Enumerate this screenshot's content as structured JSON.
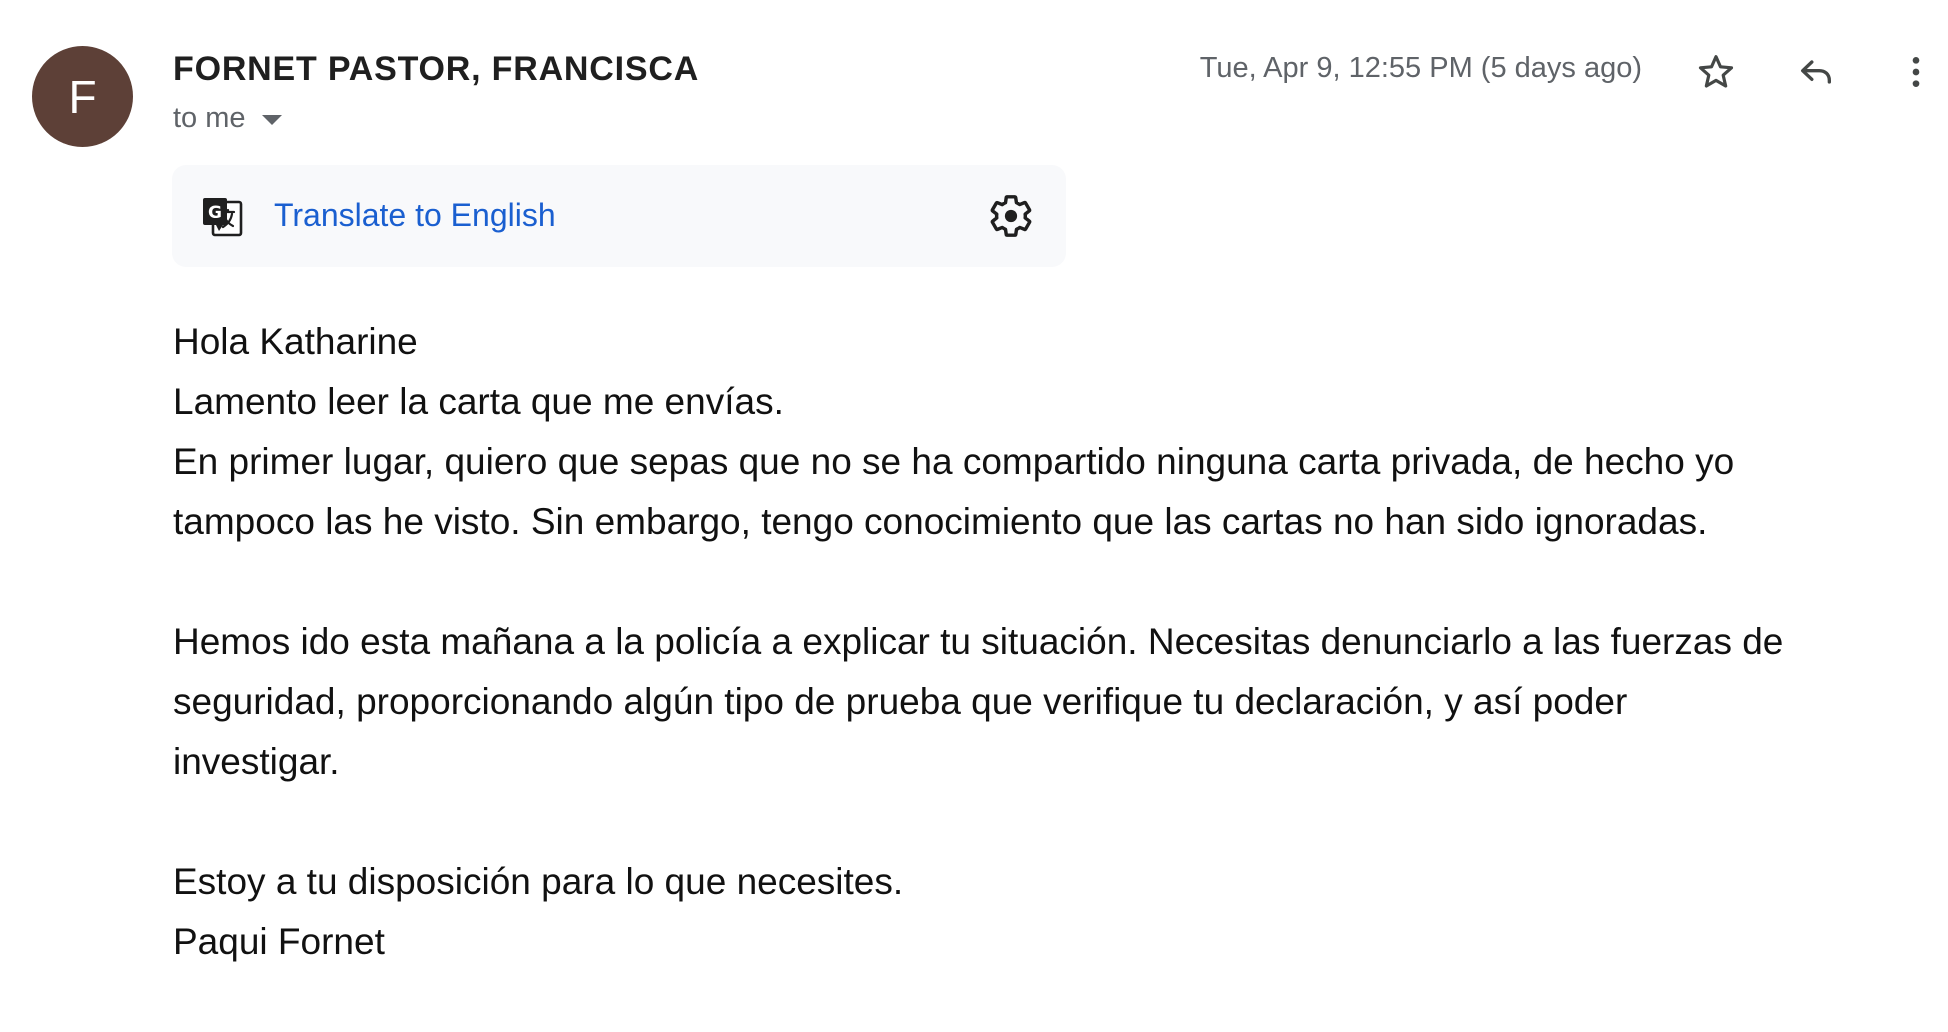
{
  "sender": {
    "avatar_letter": "F",
    "avatar_color": "#5d4037",
    "name": "FORNET PASTOR, FRANCISCA"
  },
  "recipient": {
    "label": "to me"
  },
  "timestamp": "Tue, Apr 9, 12:55 PM (5 days ago)",
  "actions": {
    "star_icon": "star-icon",
    "reply_icon": "reply-icon",
    "more_icon": "more-vert-icon"
  },
  "translate_bar": {
    "icon": "translate-icon",
    "link_label": "Translate to English",
    "settings_icon": "gear-icon"
  },
  "body": {
    "line1": "Hola Katharine",
    "line2": "Lamento leer la carta que me envías.",
    "line3": "En primer lugar, quiero que sepas que no se ha compartido ninguna carta privada, de hecho yo",
    "line4": "tampoco las he visto. Sin embargo, tengo conocimiento que las cartas no han sido ignoradas.",
    "line5": "Hemos ido esta mañana a la policía a explicar tu situación. Necesitas denunciarlo a las fuerzas de",
    "line6": "seguridad, proporcionando algún tipo de prueba que verifique tu declaración, y así poder",
    "line7": "investigar.",
    "line8": "Estoy a tu disposición para lo que necesites.",
    "line9": "Paqui Fornet"
  },
  "colors": {
    "link": "#1a5fd0",
    "secondary_text": "#5f6368",
    "translate_bar_bg": "#f8f9fb"
  }
}
